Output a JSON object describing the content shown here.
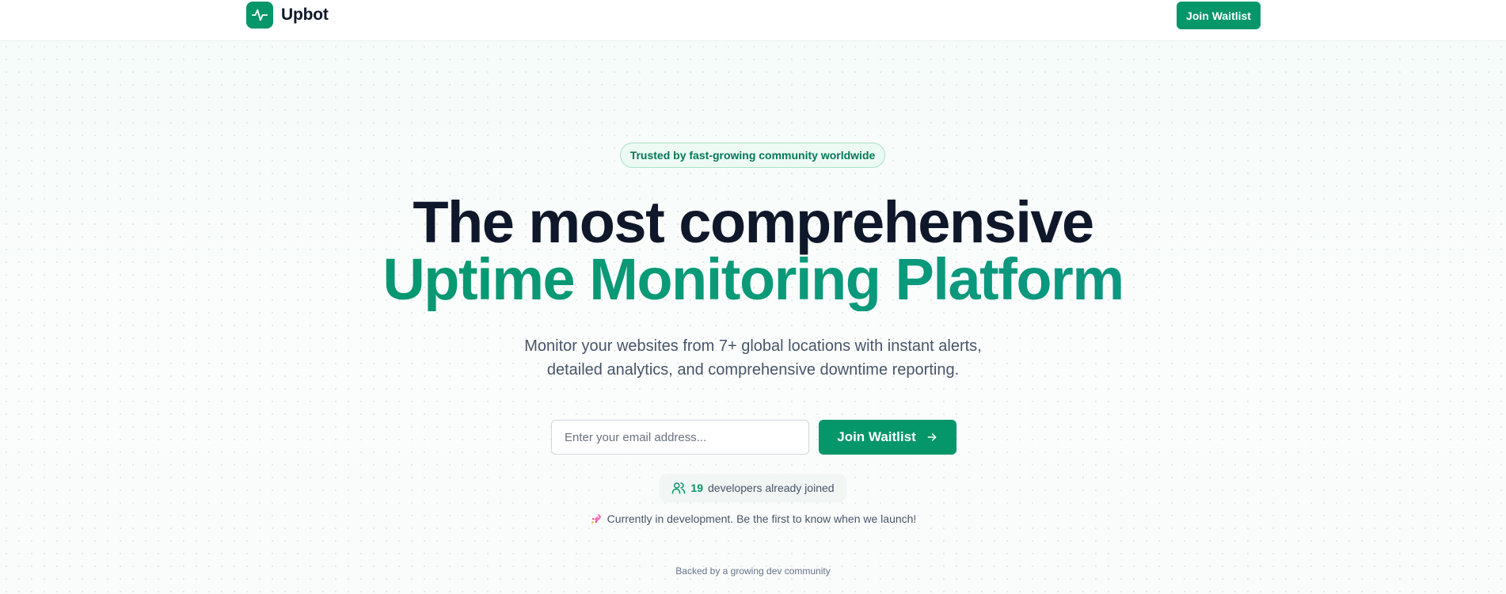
{
  "header": {
    "brand": "Upbot",
    "join_button": "Join Waitlist"
  },
  "hero": {
    "badge": "Trusted by fast-growing community worldwide",
    "headline_line1": "The most comprehensive",
    "headline_line2": "Uptime Monitoring Platform",
    "subtitle_line1": "Monitor your websites from 7+ global locations with instant alerts,",
    "subtitle_line2": "detailed analytics, and comprehensive downtime reporting."
  },
  "signup": {
    "email_placeholder": "Enter your email address...",
    "email_value": "",
    "submit_label": "Join Waitlist"
  },
  "community": {
    "count": "19",
    "count_text": "developers already joined"
  },
  "dev_note": "Currently in development. Be the first to know when we launch!",
  "footer_note": "Backed by a growing dev community",
  "icons": {
    "logo": "activity-pulse-icon",
    "submit": "arrow-right-icon",
    "community": "users-icon",
    "dev_note": "rocket-icon"
  },
  "colors": {
    "brand": "#059669",
    "brand_teal": "#0d9488",
    "heading": "#0f172a",
    "body_text": "#475569",
    "badge_bg": "#ecfaf3",
    "badge_border": "#a7e3c9"
  }
}
